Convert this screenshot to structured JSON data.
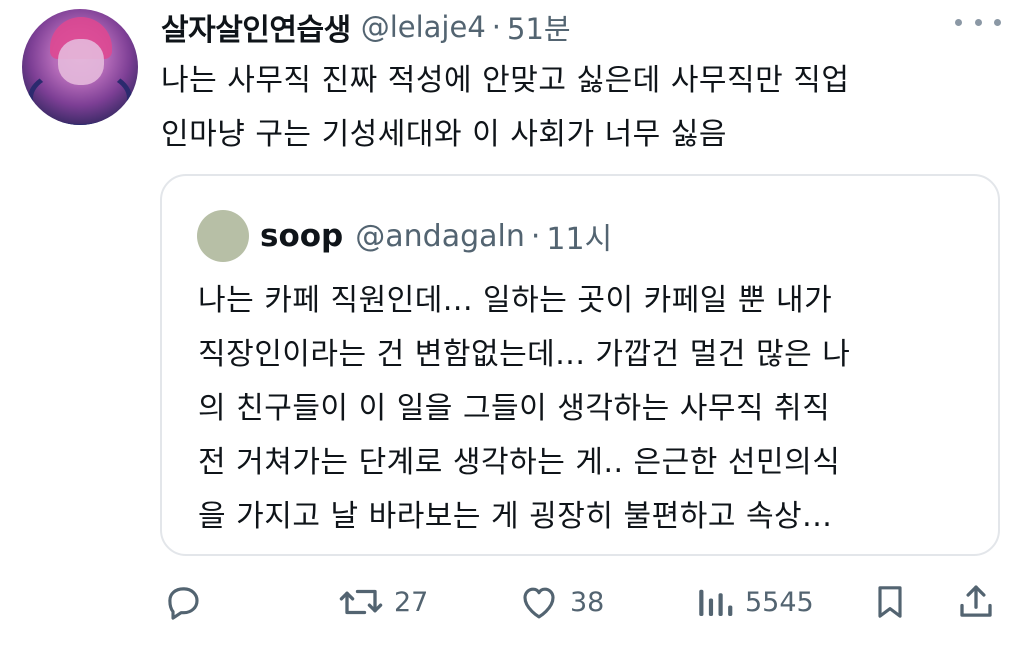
{
  "tweet": {
    "author_name": "살자살인연습생",
    "author_handle": "@lelaje4",
    "separator": "·",
    "timestamp": "51분",
    "text_lines": [
      "나는 사무직 진짜 적성에 안맞고 싫은데 사무직만 직업",
      "인마냥 구는 기성세대와 이 사회가 너무 싫음"
    ]
  },
  "quote": {
    "author_name": "soop",
    "author_handle": "@andagaln",
    "separator": "·",
    "timestamp": "11시",
    "text_lines": [
      "나는 카페 직원인데... 일하는 곳이 카페일 뿐 내가",
      "직장인이라는 건 변함없는데... 가깝건 멀건 많은 나",
      "의 친구들이 이 일을 그들이 생각하는 사무직 취직",
      "전 거쳐가는 단계로 생각하는 게.. 은근한 선민의식",
      "을 가지고 날 바라보는 게 굉장히 불편하고 속상..."
    ]
  },
  "actions": {
    "reply": {
      "icon": "reply-icon",
      "count": ""
    },
    "retweet": {
      "icon": "retweet-icon",
      "count": "27"
    },
    "like": {
      "icon": "heart-icon",
      "count": "38"
    },
    "views": {
      "icon": "views-icon",
      "count": "5545"
    },
    "bookmark": {
      "icon": "bookmark-icon",
      "count": ""
    },
    "share": {
      "icon": "share-icon",
      "count": ""
    }
  },
  "colors": {
    "text_primary": "#0f1419",
    "text_secondary": "#536471",
    "border": "#e3e6ea"
  }
}
